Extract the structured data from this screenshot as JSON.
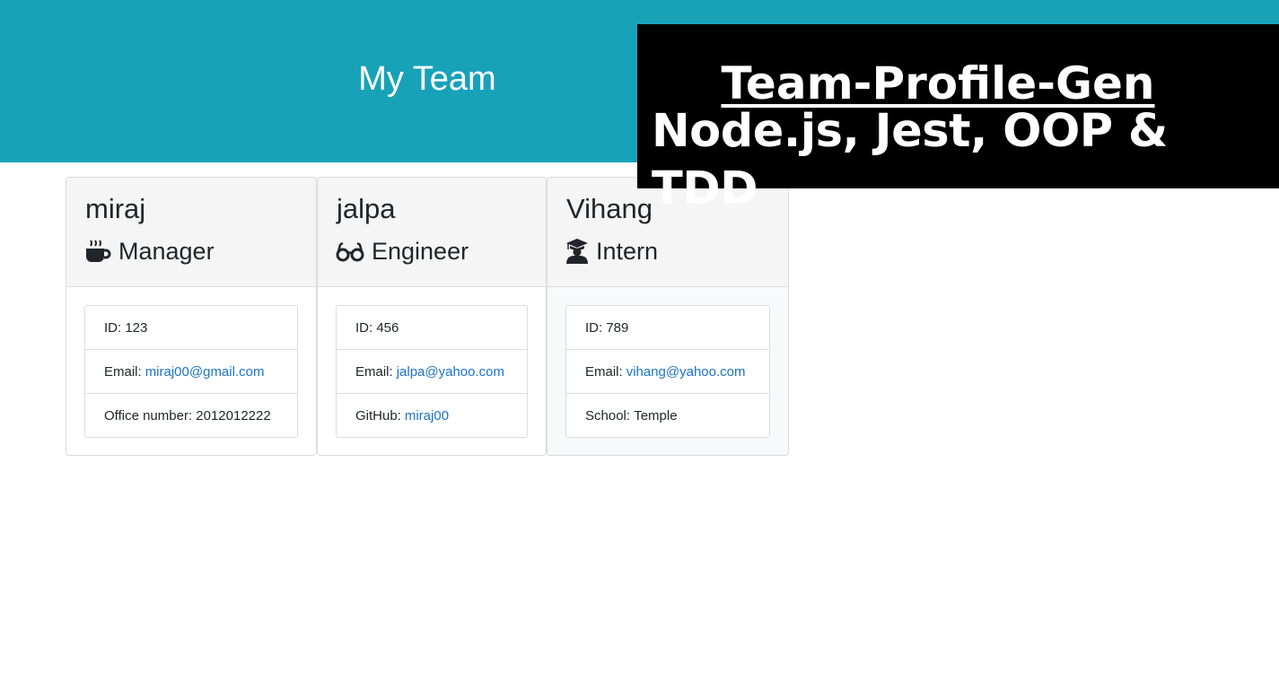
{
  "header": {
    "title": "My Team",
    "background": "#17a2b8"
  },
  "banner": {
    "title": "Team-Profile-Gen",
    "subtitle": "Node.js, Jest, OOP & TDD"
  },
  "team": [
    {
      "name": "miraj",
      "role": "Manager",
      "icon": "mug-icon",
      "id_label": "ID:",
      "id_value": "123",
      "email_label": "Email:",
      "email": "miraj00@gmail.com",
      "extra_label": "Office number:",
      "extra_value": "2012012222"
    },
    {
      "name": "jalpa",
      "role": "Engineer",
      "icon": "glasses-icon",
      "id_label": "ID:",
      "id_value": "456",
      "email_label": "Email:",
      "email": "jalpa@yahoo.com",
      "extra_label": "GitHub:",
      "extra_value": "miraj00"
    },
    {
      "name": "Vihang",
      "role": "Intern",
      "icon": "graduate-icon",
      "id_label": "ID:",
      "id_value": "789",
      "email_label": "Email:",
      "email": "vihang@yahoo.com",
      "extra_label": "School:",
      "extra_value": "Temple"
    }
  ],
  "colors": {
    "link": "#1a73c8",
    "header_bg": "#17a2b8",
    "banner_bg": "#000000"
  }
}
